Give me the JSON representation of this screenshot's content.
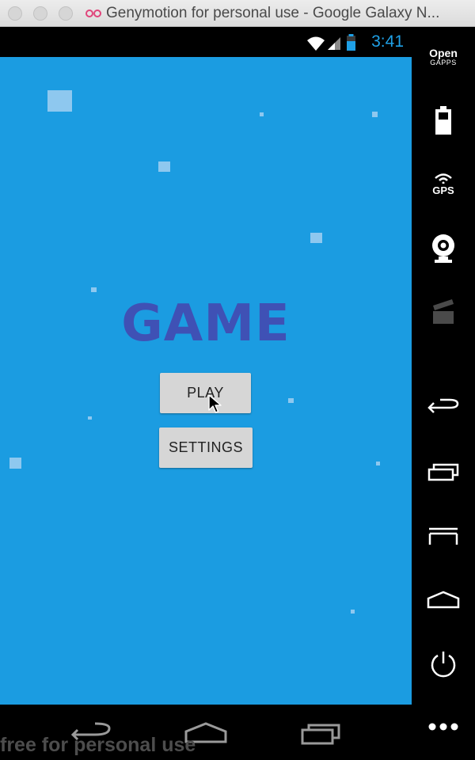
{
  "window": {
    "title": "Genymotion for personal use - Google Galaxy N..."
  },
  "status_bar": {
    "time": "3:41",
    "icons": [
      "wifi-icon",
      "signal-icon",
      "battery-icon"
    ]
  },
  "game": {
    "title": "GAME",
    "play_label": "PLAY",
    "settings_label": "SETTINGS",
    "colors": {
      "background": "#1b9ce1",
      "title": "#3f51b5",
      "particle": "#8ec8ef",
      "button": "#d6d6d6"
    }
  },
  "sidebar": {
    "opengapps_line1": "Open",
    "opengapps_line2": "GAPPS",
    "gps_label": "GPS",
    "items": [
      "battery-icon",
      "gps-icon",
      "webcam-icon",
      "media-icon",
      "back-icon",
      "recent-apps-icon",
      "menu-icon",
      "home-icon",
      "power-icon",
      "more-icon"
    ]
  },
  "nav_bar": {
    "items": [
      "back-icon",
      "home-icon",
      "recent-apps-icon"
    ]
  },
  "watermark": "free for personal use"
}
